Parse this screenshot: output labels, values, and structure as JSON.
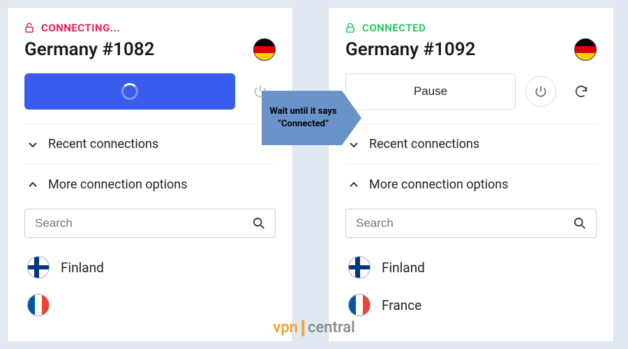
{
  "left": {
    "status_label": "CONNECTING...",
    "server": "Germany #1082",
    "sections": {
      "recent": "Recent connections",
      "more": "More connection options"
    },
    "search_placeholder": "Search",
    "countries": [
      "Finland"
    ]
  },
  "right": {
    "status_label": "CONNECTED",
    "server": "Germany #1092",
    "pause_label": "Pause",
    "sections": {
      "recent": "Recent connections",
      "more": "More connection options"
    },
    "search_placeholder": "Search",
    "countries": [
      "Finland",
      "France"
    ]
  },
  "annotation": "Wait until it says “Connected”",
  "watermark": {
    "a": "vpn",
    "b": "central"
  },
  "colors": {
    "connecting": "#ec1e5b",
    "connected": "#2fc661",
    "primary_btn": "#3a5ced",
    "arrow": "#6a93c9"
  }
}
